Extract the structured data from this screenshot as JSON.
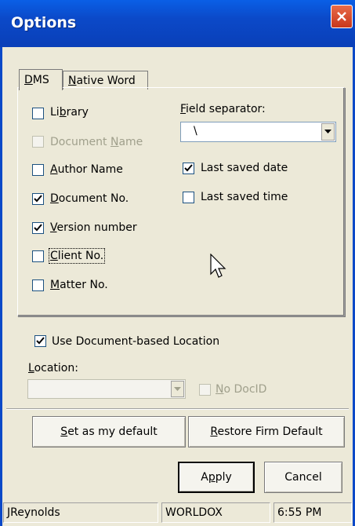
{
  "window": {
    "title": "Options"
  },
  "tabs": [
    {
      "label": "DMS",
      "accel": "D",
      "rest": "MS"
    },
    {
      "label": "Native Word",
      "accel": "N",
      "rest": "ative Word"
    }
  ],
  "checkboxes": {
    "library": {
      "pre": "Li",
      "accel": "b",
      "post": "rary",
      "checked": false
    },
    "document_name": {
      "pre": "Document ",
      "accel": "N",
      "post": "ame",
      "checked": false,
      "disabled": true
    },
    "author_name": {
      "pre": "",
      "accel": "A",
      "post": "uthor Name",
      "checked": false
    },
    "document_no": {
      "pre": "",
      "accel": "D",
      "post": "ocument No.",
      "checked": true
    },
    "version_number": {
      "pre": "",
      "accel": "V",
      "post": "ersion number",
      "checked": true
    },
    "client_no": {
      "pre": "",
      "accel": "C",
      "post": "lient No.",
      "checked": false
    },
    "matter_no": {
      "pre": "",
      "accel": "M",
      "post": "atter No.",
      "checked": false
    },
    "last_saved_date": {
      "label": "Last saved date",
      "checked": true
    },
    "last_saved_time": {
      "label": "Last saved time",
      "checked": false
    },
    "use_document_location": {
      "label": "Use Document-based Location",
      "checked": true
    },
    "no_docid": {
      "pre": "",
      "accel": "N",
      "post": "o DocID",
      "checked": false,
      "disabled": true
    }
  },
  "field_separator": {
    "pre": "",
    "accel": "F",
    "post": "ield separator:",
    "value": "\\"
  },
  "location": {
    "pre": "",
    "accel": "L",
    "post": "ocation:",
    "value": ""
  },
  "buttons": {
    "set_default": {
      "pre": "",
      "accel": "S",
      "post": "et as my default"
    },
    "restore_default": {
      "pre": "",
      "accel": "R",
      "post": "estore Firm Default"
    },
    "apply": {
      "pre": "A",
      "accel": "p",
      "post": "ply"
    },
    "cancel": {
      "label": "Cancel"
    }
  },
  "status_bar": {
    "user": "JReynolds",
    "app": "WORLDOX",
    "time": "6:55 PM"
  },
  "colors": {
    "title_bar": "#0b49c8",
    "face": "#ece9d8"
  }
}
